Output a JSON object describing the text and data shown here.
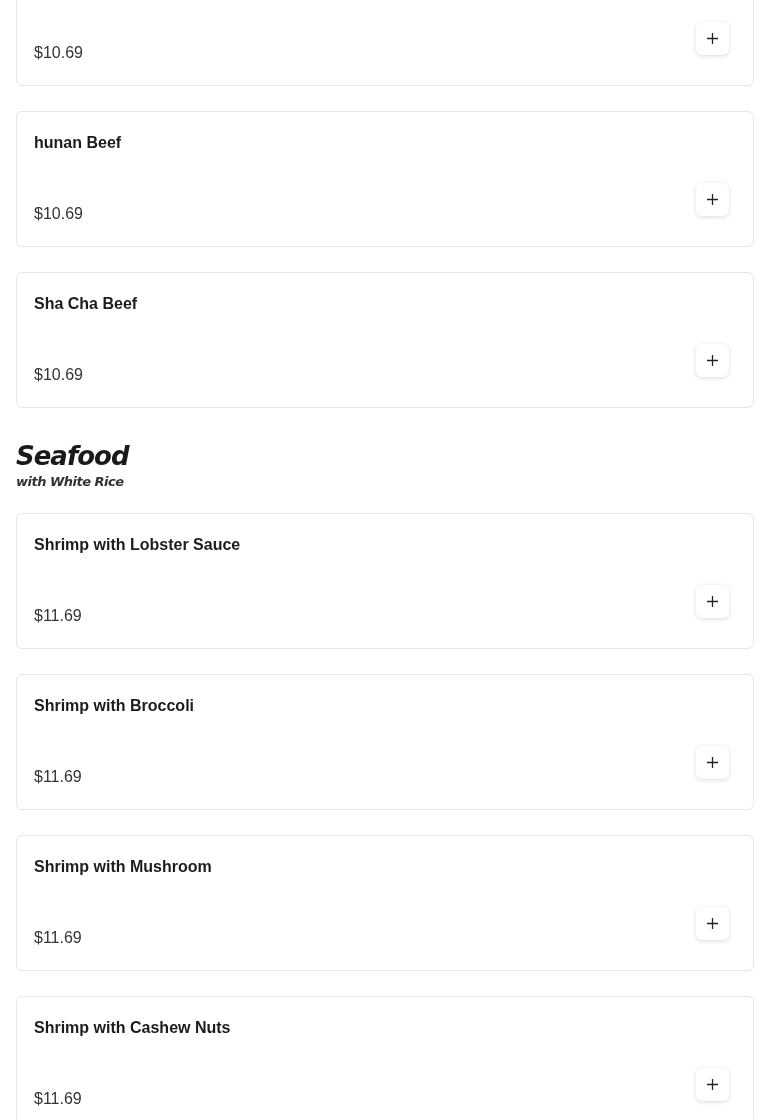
{
  "sections": [
    {
      "items": [
        {
          "price": "$10.69"
        },
        {
          "name": "hunan Beef",
          "price": "$10.69"
        },
        {
          "name": "Sha Cha Beef",
          "price": "$10.69"
        }
      ]
    },
    {
      "title": "Seafood",
      "subtitle": "with White Rice",
      "items": [
        {
          "name": "Shrimp with Lobster Sauce",
          "price": "$11.69"
        },
        {
          "name": "Shrimp with Broccoli",
          "price": "$11.69"
        },
        {
          "name": "Shrimp with Mushroom",
          "price": "$11.69"
        },
        {
          "name": "Shrimp with Cashew Nuts",
          "price": "$11.69"
        }
      ]
    }
  ]
}
